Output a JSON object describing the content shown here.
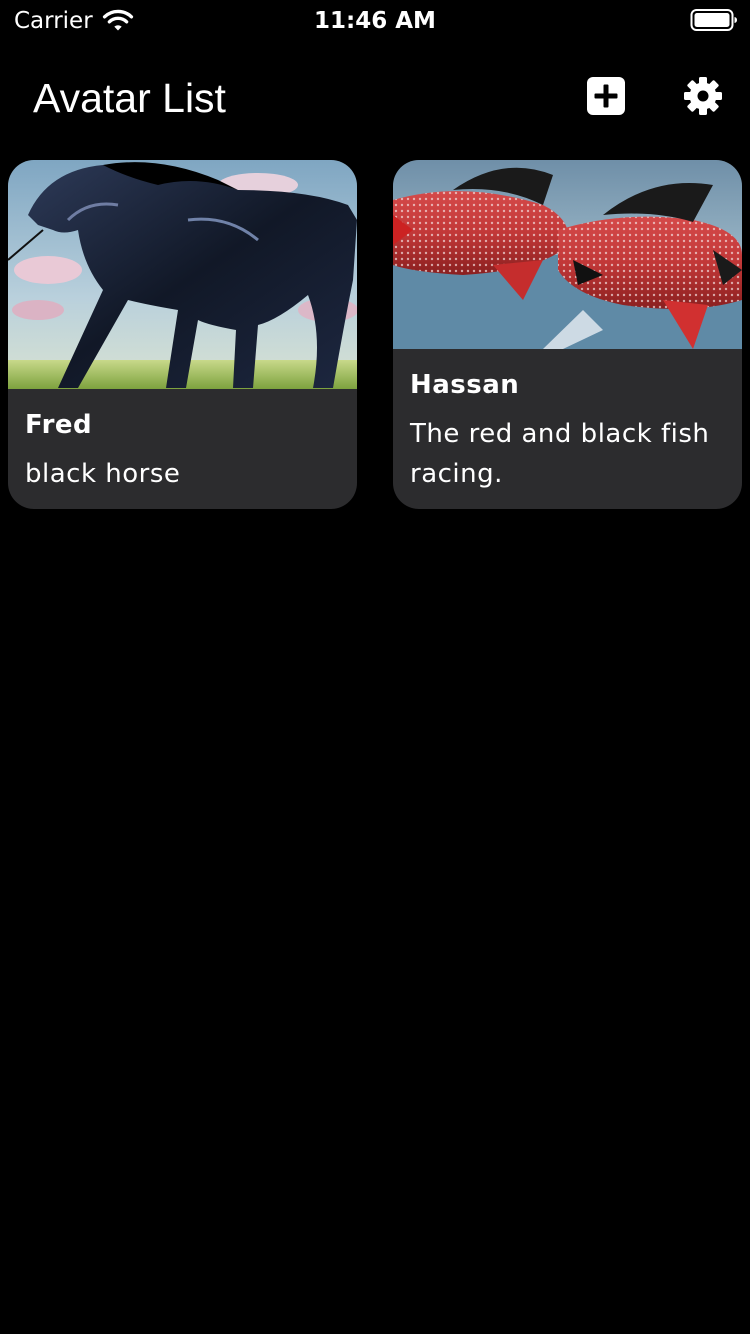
{
  "status_bar": {
    "carrier": "Carrier",
    "time": "11:46 AM",
    "wifi_icon": "wifi-icon",
    "battery_icon": "battery-full-icon"
  },
  "header": {
    "title": "Avatar List",
    "add_icon": "plus-square-icon",
    "settings_icon": "gear-icon"
  },
  "avatars": [
    {
      "name": "Fred",
      "description": "black horse",
      "image_subject": "black horse galloping"
    },
    {
      "name": "Hassan",
      "description": "The red and black fish racing.",
      "image_subject": "red and black fish"
    }
  ],
  "colors": {
    "background": "#000000",
    "card": "#2c2c2e",
    "text": "#ffffff"
  }
}
